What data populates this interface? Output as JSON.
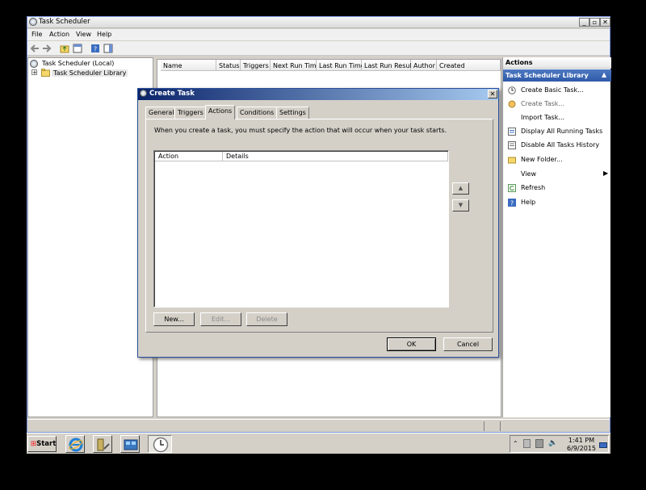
{
  "window": {
    "title": "Task Scheduler"
  },
  "menubar": [
    "File",
    "Action",
    "View",
    "Help"
  ],
  "tree": {
    "root": "Task Scheduler (Local)",
    "library": "Task Scheduler Library",
    "expander": "+"
  },
  "list_columns": [
    "Name",
    "Status",
    "Triggers",
    "Next Run Time",
    "Last Run Time",
    "Last Run Result",
    "Author",
    "Created"
  ],
  "actions_panel": {
    "header": "Actions",
    "section": "Task Scheduler Library",
    "items": [
      {
        "label": "Create Basic Task...",
        "icon": "create-basic-task-icon"
      },
      {
        "label": "Create Task...",
        "icon": "create-task-icon"
      },
      {
        "label": "Import Task...",
        "icon": "import-task-icon"
      },
      {
        "label": "Display All Running Tasks",
        "icon": "display-running-icon"
      },
      {
        "label": "Disable All Tasks History",
        "icon": "disable-history-icon"
      },
      {
        "label": "New Folder...",
        "icon": "new-folder-icon"
      },
      {
        "label": "View",
        "icon": "view-icon"
      },
      {
        "label": "Refresh",
        "icon": "refresh-icon"
      },
      {
        "label": "Help",
        "icon": "help-icon"
      }
    ]
  },
  "dialog": {
    "title": "Create Task",
    "tabs": [
      "General",
      "Triggers",
      "Actions",
      "Conditions",
      "Settings"
    ],
    "active_tab": "Actions",
    "description": "When you create a task, you must specify the action that will occur when your task starts.",
    "columns": [
      "Action",
      "Details"
    ],
    "buttons": {
      "new": "New...",
      "edit": "Edit...",
      "delete": "Delete",
      "ok": "OK",
      "cancel": "Cancel"
    }
  },
  "taskbar": {
    "start": "Start",
    "time": "1:41 PM",
    "date": "6/9/2015"
  }
}
